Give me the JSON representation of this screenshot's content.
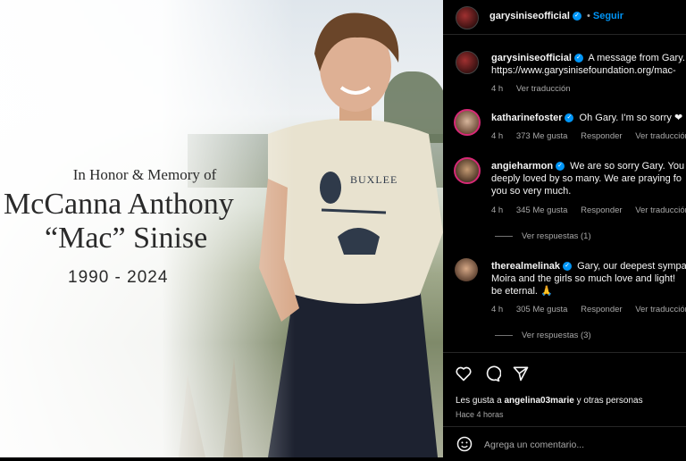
{
  "memorial": {
    "honor": "In Honor & Memory of",
    "name_line1": "McCanna Anthony",
    "name_line2": "“Mac” Sinise",
    "years": "1990 - 2024",
    "shirt_text": "BUXLEE"
  },
  "header": {
    "username": "garysiniseofficial",
    "follow": "Seguir"
  },
  "caption": {
    "username": "garysiniseofficial",
    "text": "A message from Gary.",
    "link": "https://www.garysinisefoundation.org/mac-",
    "time": "4 h",
    "translate": "Ver traducción"
  },
  "comments": [
    {
      "username": "katharinefoster",
      "text": "Oh Gary. I'm so sorry ❤",
      "time": "4 h",
      "likes": "373 Me gusta",
      "reply": "Responder",
      "translate": "Ver traducción"
    },
    {
      "username": "angieharmon",
      "line1": "We are so sorry Gary. You a",
      "line2": "deeply loved by so many. We are praying fo",
      "line3": "you so very much.",
      "time": "4 h",
      "likes": "345 Me gusta",
      "reply": "Responder",
      "translate": "Ver traducción",
      "replies": "Ver respuestas (1)"
    },
    {
      "username": "therealmelinak",
      "line1": "Gary, our deepest sympa",
      "line2": "Moira and the girls so much love and light!",
      "line3": "be eternal. 🙏",
      "time": "4 h",
      "likes": "305 Me gusta",
      "reply": "Responder",
      "translate": "Ver traducción",
      "replies": "Ver respuestas (3)"
    }
  ],
  "footer": {
    "likes_prefix": "Les gusta a ",
    "likes_user": "angelina03marie",
    "likes_suffix": " y otras personas",
    "time": "Hace 4 horas",
    "add_comment_placeholder": "Agrega un comentario..."
  },
  "icons": {
    "like": "heart-icon",
    "comment": "comment-icon",
    "share": "share-icon",
    "emoji": "emoji-icon",
    "verified": "verified-icon"
  },
  "colors": {
    "link": "#0095f6",
    "muted": "#a8a8a8",
    "story_ring": "#d62976"
  }
}
